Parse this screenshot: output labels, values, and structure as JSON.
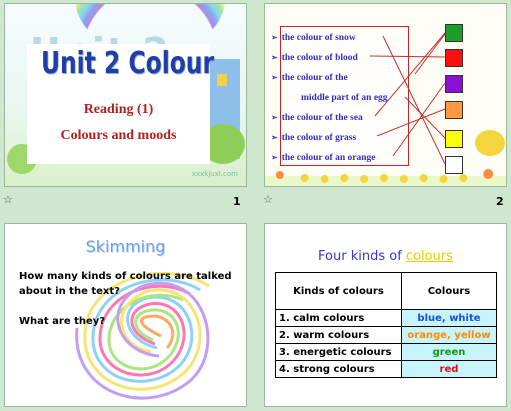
{
  "slides": [
    {
      "number": "1",
      "title": "Unit 2   Colour",
      "subtitle": "Reading (1)",
      "subtitle2": "Colours and moods",
      "watermark": "xxxkjuxl.com"
    },
    {
      "number": "2",
      "items": [
        "the colour of snow",
        "the colour of blood",
        "the colour of the",
        "middle  part of an egg",
        "the colour of the sea",
        "the colour of grass",
        "the colour of an orange"
      ],
      "swatches": [
        "#1aa02a",
        "#ff1010",
        "#8a10d8",
        "#ff9a40",
        "#ffff00",
        "#ffffff"
      ]
    },
    {
      "number": "",
      "heading": "Skimming",
      "question1_line1": "How many kinds of colours are talked",
      "question1_line2": "about in the text?",
      "question2": "What are they?"
    },
    {
      "number": "",
      "heading_main": "Four kinds of ",
      "heading_link": "colours",
      "table": {
        "headers": [
          "Kinds of colours",
          "Colours"
        ],
        "rows": [
          {
            "label": "1. calm colours",
            "value": "blue, white",
            "color": "#1a4fd6"
          },
          {
            "label": "2. warm colours",
            "value": "orange, yellow",
            "color": "#ff8a00"
          },
          {
            "label": "3. energetic colours",
            "value": "green",
            "color": "#109a10"
          },
          {
            "label": "4. strong colours",
            "value": "red",
            "color": "#e01010"
          }
        ]
      }
    }
  ],
  "footer_star": "☆"
}
